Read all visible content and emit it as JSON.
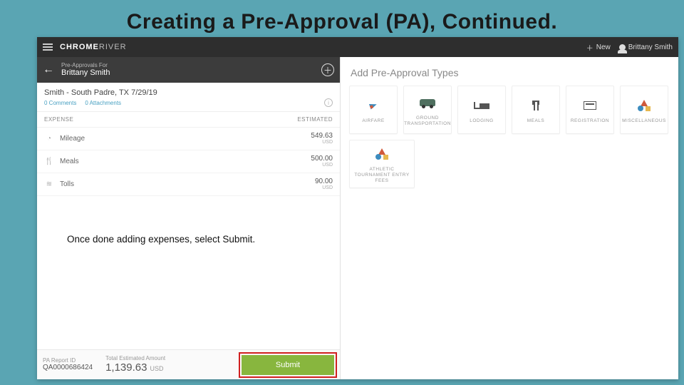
{
  "slide": {
    "title": "Creating a Pre-Approval (PA), Continued.",
    "caption": "Once done adding expenses, select Submit."
  },
  "appbar": {
    "logo_strong": "CHROME",
    "logo_light": "RIVER",
    "new_label": "New",
    "user_name": "Brittany Smith"
  },
  "leftPane": {
    "header_top": "Pre-Approvals For",
    "header_name": "Brittany Smith",
    "report_title": "Smith - South Padre, TX 7/29/19",
    "comments": "0 Comments",
    "attachments": "0 Attachments",
    "column_expense": "EXPENSE",
    "column_estimated": "ESTIMATED",
    "expenses": [
      {
        "label": "Mileage",
        "amount": "549.63",
        "currency": "USD",
        "icon": "speedometer"
      },
      {
        "label": "Meals",
        "amount": "500.00",
        "currency": "USD",
        "icon": "utensils"
      },
      {
        "label": "Tolls",
        "amount": "90.00",
        "currency": "USD",
        "icon": "road"
      }
    ],
    "footer": {
      "report_id_label": "PA Report ID",
      "report_id_value": "QA0000686424",
      "total_label": "Total Estimated Amount",
      "total_value": "1,139.63",
      "total_currency": "USD",
      "submit_label": "Submit"
    }
  },
  "rightPane": {
    "title": "Add Pre-Approval Types",
    "tiles": [
      {
        "name": "airfare",
        "label": "AIRFARE"
      },
      {
        "name": "ground-transport",
        "label": "GROUND TRANSPORTATION"
      },
      {
        "name": "lodging",
        "label": "LODGING"
      },
      {
        "name": "meals",
        "label": "MEALS"
      },
      {
        "name": "registration",
        "label": "REGISTRATION"
      },
      {
        "name": "miscellaneous",
        "label": "MISCELLANEOUS"
      },
      {
        "name": "athletic-tournament",
        "label": "ATHLETIC TOURNAMENT ENTRY FEES"
      }
    ]
  }
}
